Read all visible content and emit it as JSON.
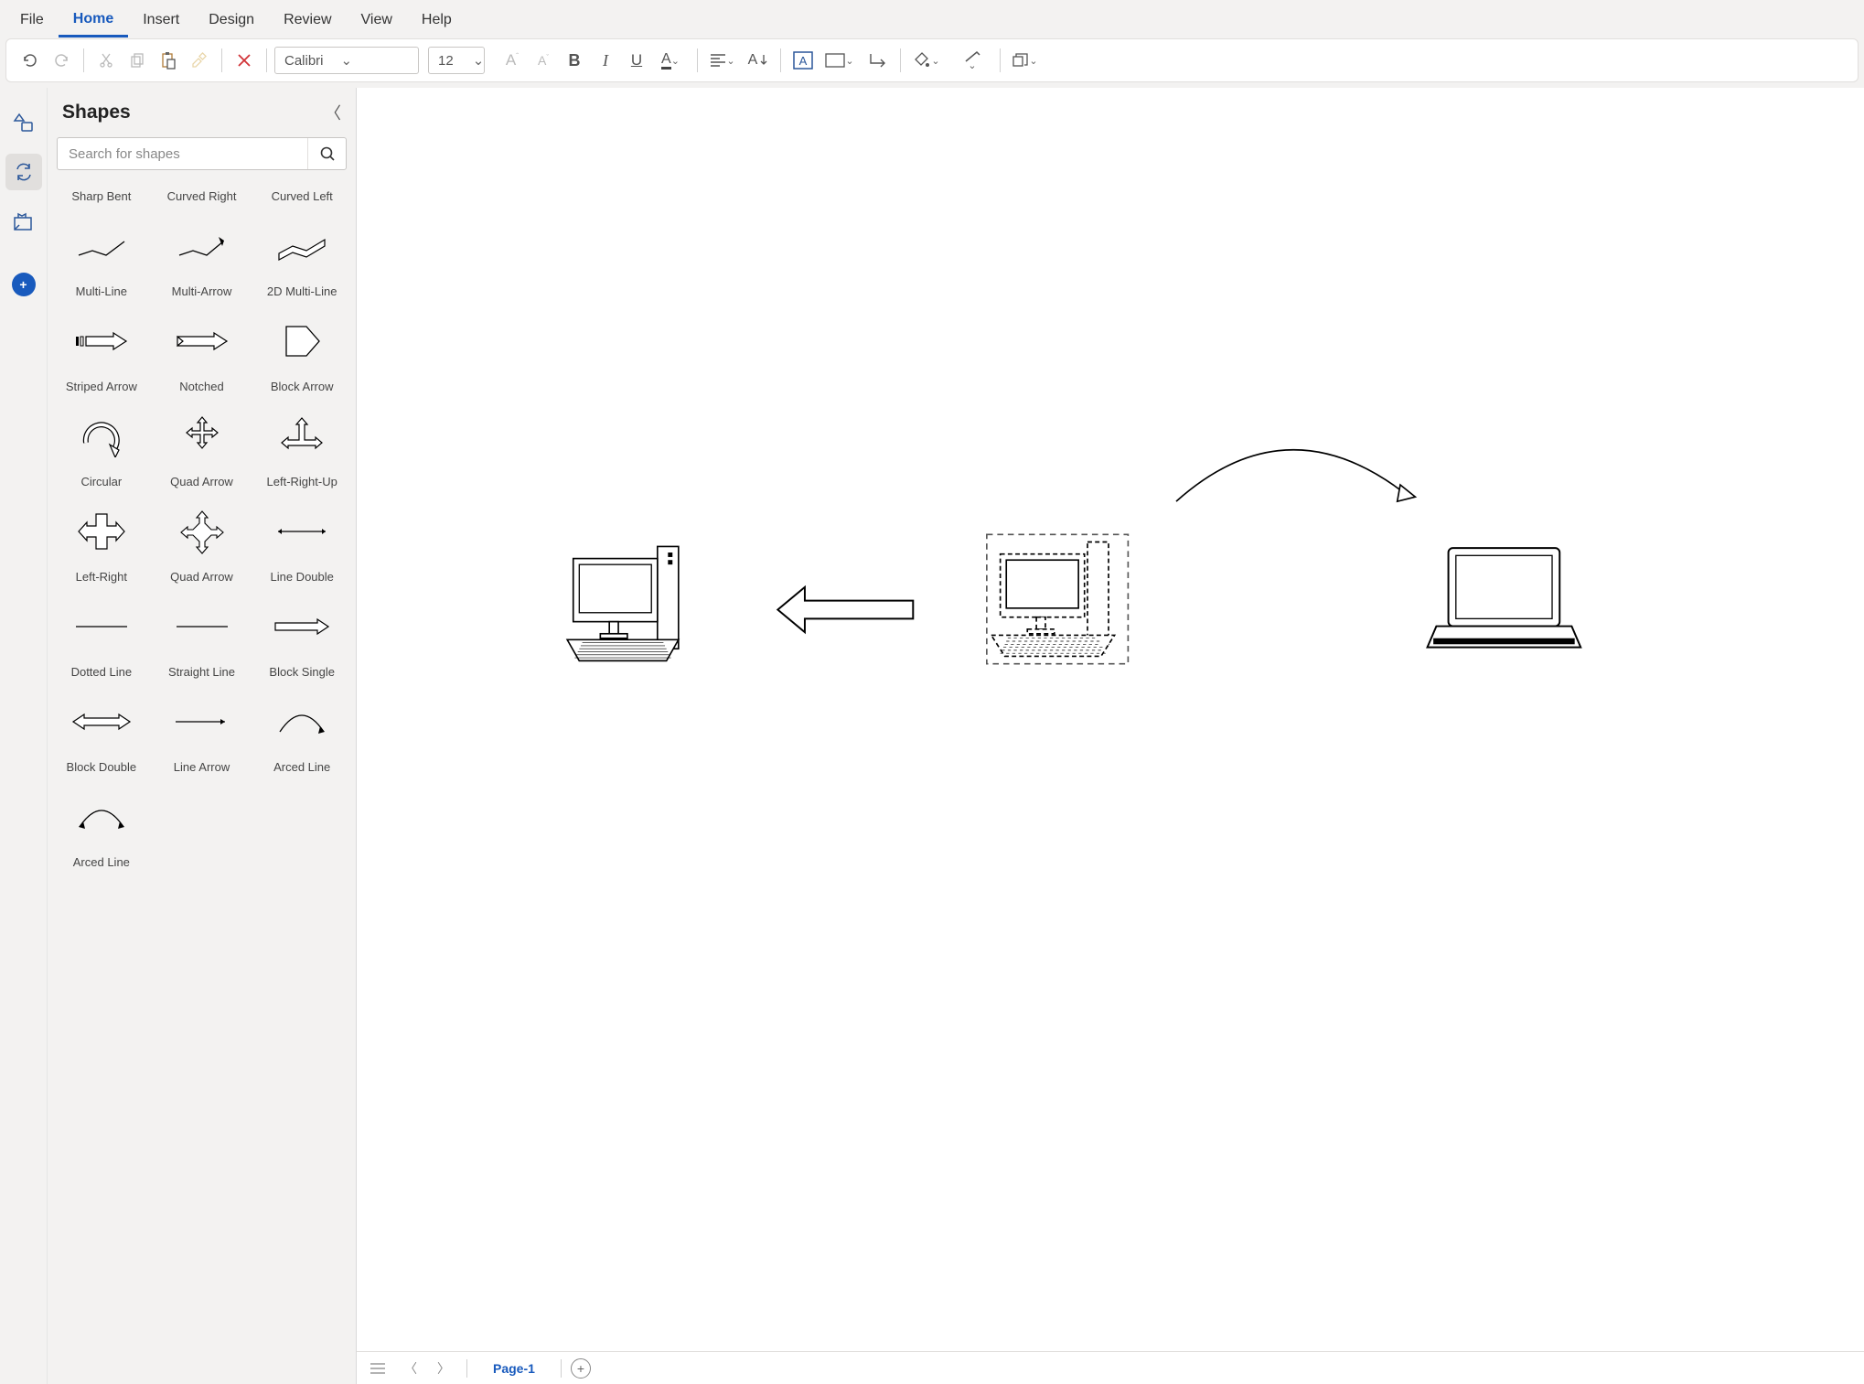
{
  "menu": {
    "items": [
      "File",
      "Home",
      "Insert",
      "Design",
      "Review",
      "View",
      "Help"
    ],
    "active": "Home"
  },
  "ribbon": {
    "font_name": "Calibri",
    "font_size": "12"
  },
  "panel": {
    "title": "Shapes",
    "search_placeholder": "Search for shapes",
    "rows": [
      {
        "labels_only": true,
        "cells": [
          {
            "label": "Sharp Bent"
          },
          {
            "label": "Curved Right"
          },
          {
            "label": "Curved Left"
          }
        ]
      },
      {
        "cells": [
          {
            "label": "Multi-Line",
            "icon": "multiline"
          },
          {
            "label": "Multi-Arrow",
            "icon": "multiarrow"
          },
          {
            "label": "2D Multi-Line",
            "icon": "multiline2d"
          }
        ]
      },
      {
        "cells": [
          {
            "label": "Striped Arrow",
            "icon": "striped"
          },
          {
            "label": "Notched",
            "icon": "notched"
          },
          {
            "label": "Block Arrow",
            "icon": "blockarrow"
          }
        ]
      },
      {
        "cells": [
          {
            "label": "Circular",
            "icon": "circular"
          },
          {
            "label": "Quad Arrow",
            "icon": "quad"
          },
          {
            "label": "Left-Right-Up",
            "icon": "lru"
          }
        ]
      },
      {
        "cells": [
          {
            "label": "Left-Right",
            "icon": "leftright"
          },
          {
            "label": "Quad Arrow",
            "icon": "quad2"
          },
          {
            "label": "Line Double",
            "icon": "linedouble"
          }
        ]
      },
      {
        "cells": [
          {
            "label": "Dotted Line",
            "icon": "dotted"
          },
          {
            "label": "Straight Line",
            "icon": "straight"
          },
          {
            "label": "Block Single",
            "icon": "blocksingle"
          }
        ]
      },
      {
        "cells": [
          {
            "label": "Block Double",
            "icon": "blockdouble"
          },
          {
            "label": "Line Arrow",
            "icon": "linearrow"
          },
          {
            "label": "Arced Line",
            "icon": "arcedline"
          }
        ]
      },
      {
        "cells": [
          {
            "label": "Arced Line",
            "icon": "arcedline2"
          },
          {
            "label": "",
            "icon": ""
          },
          {
            "label": "",
            "icon": ""
          }
        ]
      }
    ]
  },
  "pagebar": {
    "tab": "Page-1"
  }
}
